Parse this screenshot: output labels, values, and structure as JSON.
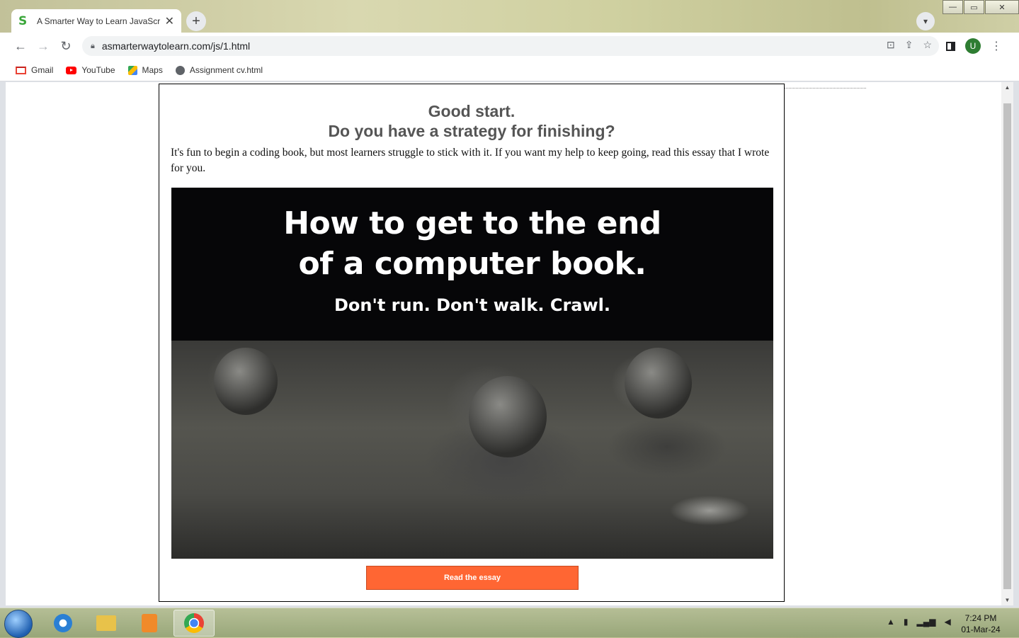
{
  "browser": {
    "tab_title": "A Smarter Way to Learn JavaScript",
    "tab_favicon": "S",
    "url": "asmarterwaytolearn.com/js/1.html",
    "profile_initial": "U",
    "bookmarks": [
      {
        "label": "Gmail",
        "icon": "gmail-icon"
      },
      {
        "label": "YouTube",
        "icon": "youtube-icon"
      },
      {
        "label": "Maps",
        "icon": "maps-icon"
      },
      {
        "label": "Assignment cv.html",
        "icon": "globe-icon"
      }
    ]
  },
  "page": {
    "headline_line1": "Good start.",
    "headline_line2": "Do you have a strategy for finishing?",
    "intro": "It's fun to begin a coding book, but most learners struggle to stick with it. If you want my help to keep going, read this essay that I wrote for you.",
    "promo_title_line1": "How to get to the end",
    "promo_title_line2": "of a computer book.",
    "promo_subtitle": "Don't run. Don't walk. Crawl.",
    "button_label": "Read the essay",
    "button_color": "#ff6633"
  },
  "taskbar": {
    "time": "7:24 PM",
    "date": "01-Mar-24"
  }
}
